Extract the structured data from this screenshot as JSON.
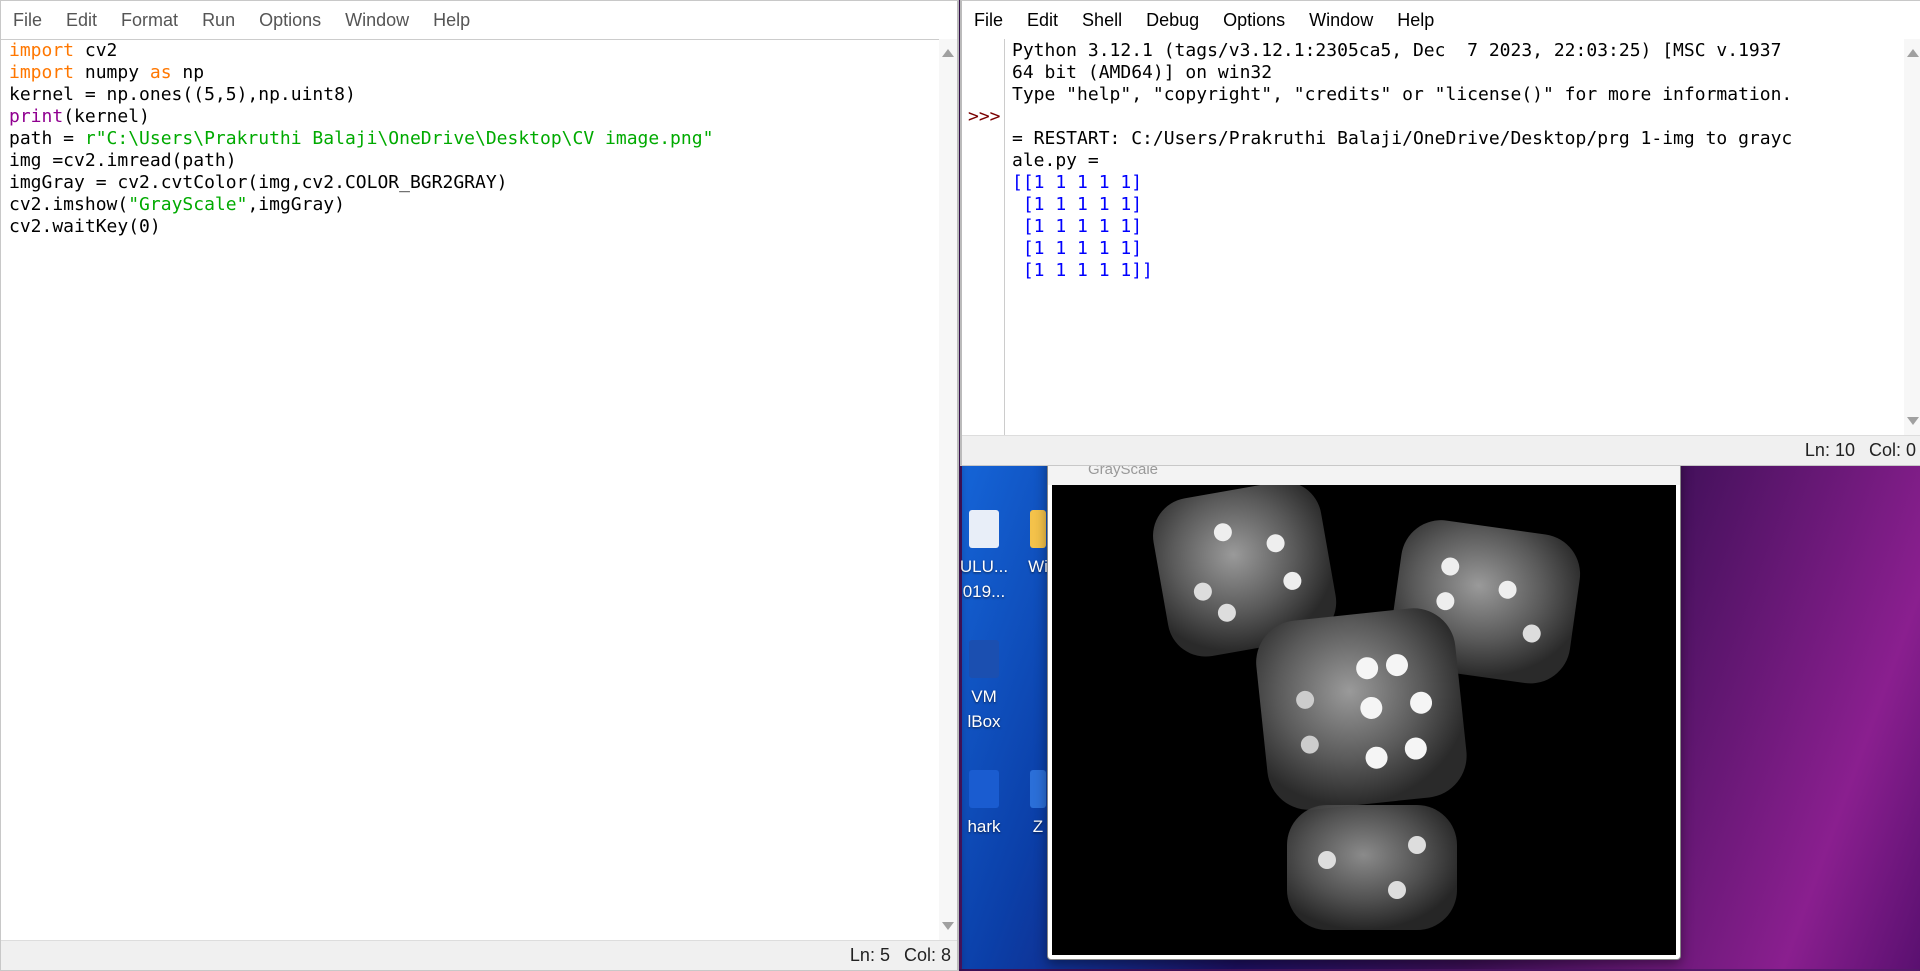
{
  "desktop": {
    "icons": [
      {
        "label": "ULU...",
        "label2": "019..."
      },
      {
        "label": "Wi"
      },
      {
        "label": "VM",
        "label2": "lBox"
      },
      {
        "label": "hark"
      },
      {
        "label": "Z"
      }
    ]
  },
  "editor": {
    "menu": [
      "File",
      "Edit",
      "Format",
      "Run",
      "Options",
      "Window",
      "Help"
    ],
    "code": {
      "l1_kw": "import",
      "l1_rest": " cv2",
      "l2_kw": "import",
      "l2_mid": " numpy ",
      "l2_kw2": "as",
      "l2_rest": " np",
      "l3": "kernel = np.ones((5,5),np.uint8)",
      "l4_bi": "print",
      "l4_rest": "(kernel)",
      "l5_pre": "path = ",
      "l5_str": "r\"C:\\Users\\Prakruthi Balaji\\OneDrive\\Desktop\\CV image.png\"",
      "l6": "img =cv2.imread(path)",
      "l7": "imgGray = cv2.cvtColor(img,cv2.COLOR_BGR2GRAY)",
      "l8_pre": "cv2.imshow(",
      "l8_str": "\"GrayScale\"",
      "l8_rest": ",imgGray)",
      "l9": "cv2.waitKey(0)"
    },
    "status": {
      "ln": "Ln: 5",
      "col": "Col: 8"
    }
  },
  "shell": {
    "menu": [
      "File",
      "Edit",
      "Shell",
      "Debug",
      "Options",
      "Window",
      "Help"
    ],
    "prompt": ">>>",
    "lines": [
      "Python 3.12.1 (tags/v3.12.1:2305ca5, Dec  7 2023, 22:03:25) [MSC v.1937",
      "64 bit (AMD64)] on win32",
      "Type \"help\", \"copyright\", \"credits\" or \"license()\" for more information.",
      "",
      "= RESTART: C:/Users/Prakruthi Balaji/OneDrive/Desktop/prg 1-img to grayc",
      "ale.py ="
    ],
    "output": [
      "[[1 1 1 1 1]",
      " [1 1 1 1 1]",
      " [1 1 1 1 1]",
      " [1 1 1 1 1]",
      " [1 1 1 1 1]]"
    ],
    "status": {
      "ln": "Ln: 10",
      "col": "Col: 0"
    }
  },
  "grayscale_window": {
    "title": "GrayScale"
  }
}
